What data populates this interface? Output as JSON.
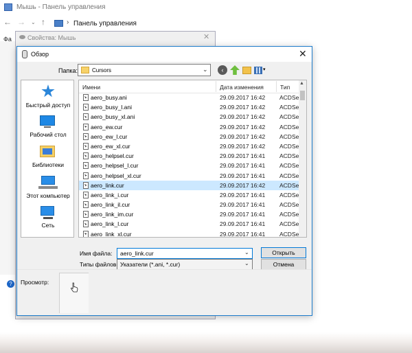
{
  "control_panel": {
    "title": "Мышь - Панель управления",
    "path": "Панель управления",
    "path_separator": "›",
    "partial_menu": "Фа",
    "help_glyph": "?"
  },
  "mouse_properties": {
    "title": "Свойства: Мышь",
    "close_glyph": "✕"
  },
  "open_dialog": {
    "title": "Обзор",
    "close_glyph": "✕",
    "folder_label": "Папка:",
    "folder_value": "Cursors",
    "places": [
      {
        "label": "Быстрый доступ",
        "icon": "star-icon"
      },
      {
        "label": "Рабочий стол",
        "icon": "desktop-icon"
      },
      {
        "label": "Библиотеки",
        "icon": "libraries-icon"
      },
      {
        "label": "Этот компьютер",
        "icon": "computer-icon"
      },
      {
        "label": "Сеть",
        "icon": "network-icon"
      }
    ],
    "columns": {
      "name": "Имени",
      "date": "Дата изменения",
      "type": "Тип"
    },
    "files": [
      {
        "name": "aero_busy.ani",
        "date": "29.09.2017 16:42",
        "type": "ACDSe"
      },
      {
        "name": "aero_busy_l.ani",
        "date": "29.09.2017 16:42",
        "type": "ACDSe"
      },
      {
        "name": "aero_busy_xl.ani",
        "date": "29.09.2017 16:42",
        "type": "ACDSe"
      },
      {
        "name": "aero_ew.cur",
        "date": "29.09.2017 16:42",
        "type": "ACDSe"
      },
      {
        "name": "aero_ew_l.cur",
        "date": "29.09.2017 16:42",
        "type": "ACDSe"
      },
      {
        "name": "aero_ew_xl.cur",
        "date": "29.09.2017 16:42",
        "type": "ACDSe"
      },
      {
        "name": "aero_helpsel.cur",
        "date": "29.09.2017 16:41",
        "type": "ACDSe"
      },
      {
        "name": "aero_helpsel_l.cur",
        "date": "29.09.2017 16:41",
        "type": "ACDSe"
      },
      {
        "name": "aero_helpsel_xl.cur",
        "date": "29.09.2017 16:41",
        "type": "ACDSe"
      },
      {
        "name": "aero_link.cur",
        "date": "29.09.2017 16:42",
        "type": "ACDSe",
        "selected": true
      },
      {
        "name": "aero_link_i.cur",
        "date": "29.09.2017 16:41",
        "type": "ACDSe"
      },
      {
        "name": "aero_link_il.cur",
        "date": "29.09.2017 16:41",
        "type": "ACDSe"
      },
      {
        "name": "aero_link_im.cur",
        "date": "29.09.2017 16:41",
        "type": "ACDSe"
      },
      {
        "name": "aero_link_l.cur",
        "date": "29.09.2017 16:41",
        "type": "ACDSe"
      },
      {
        "name": "aero_link_xl.cur",
        "date": "29.09.2017 16:41",
        "type": "ACDSe"
      }
    ],
    "filename_label": "Имя файла:",
    "filename_value": "aero_link.cur",
    "filetype_label": "Типы файлов:",
    "filetype_value": "Указатели (*.ani, *.cur)",
    "open_button": "Открыть",
    "cancel_button": "Отмена",
    "preview_label": "Просмотр:"
  }
}
